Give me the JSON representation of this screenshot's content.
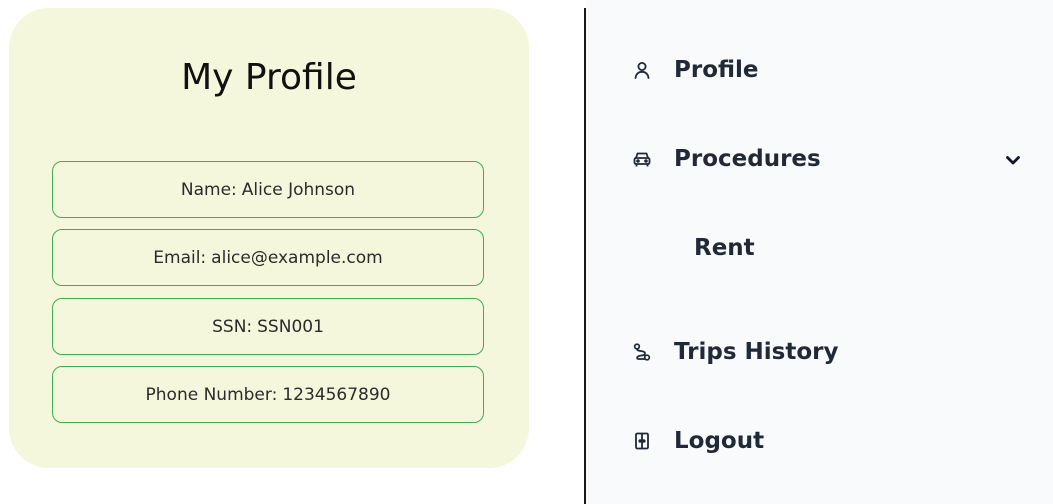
{
  "profile": {
    "title": "My Profile",
    "fields": [
      {
        "label": "Name:",
        "value": "Alice Johnson"
      },
      {
        "label": "Email:",
        "value": "alice@example.com"
      },
      {
        "label": "SSN:",
        "value": "SSN001"
      },
      {
        "label": "Phone Number:",
        "value": "1234567890"
      }
    ]
  },
  "menu": {
    "profile": {
      "label": "Profile",
      "icon": "user-icon"
    },
    "procedures": {
      "label": "Procedures",
      "icon": "car-icon",
      "expanded": true
    },
    "rent": {
      "label": "Rent"
    },
    "trips_history": {
      "label": "Trips History",
      "icon": "route-icon"
    },
    "logout": {
      "label": "Logout",
      "icon": "door-exit-icon"
    }
  },
  "colors": {
    "card_background": "#f4f7dc",
    "field_border": "#3fae54",
    "menu_background": "#f9fafb",
    "menu_text": "#1f2937"
  }
}
